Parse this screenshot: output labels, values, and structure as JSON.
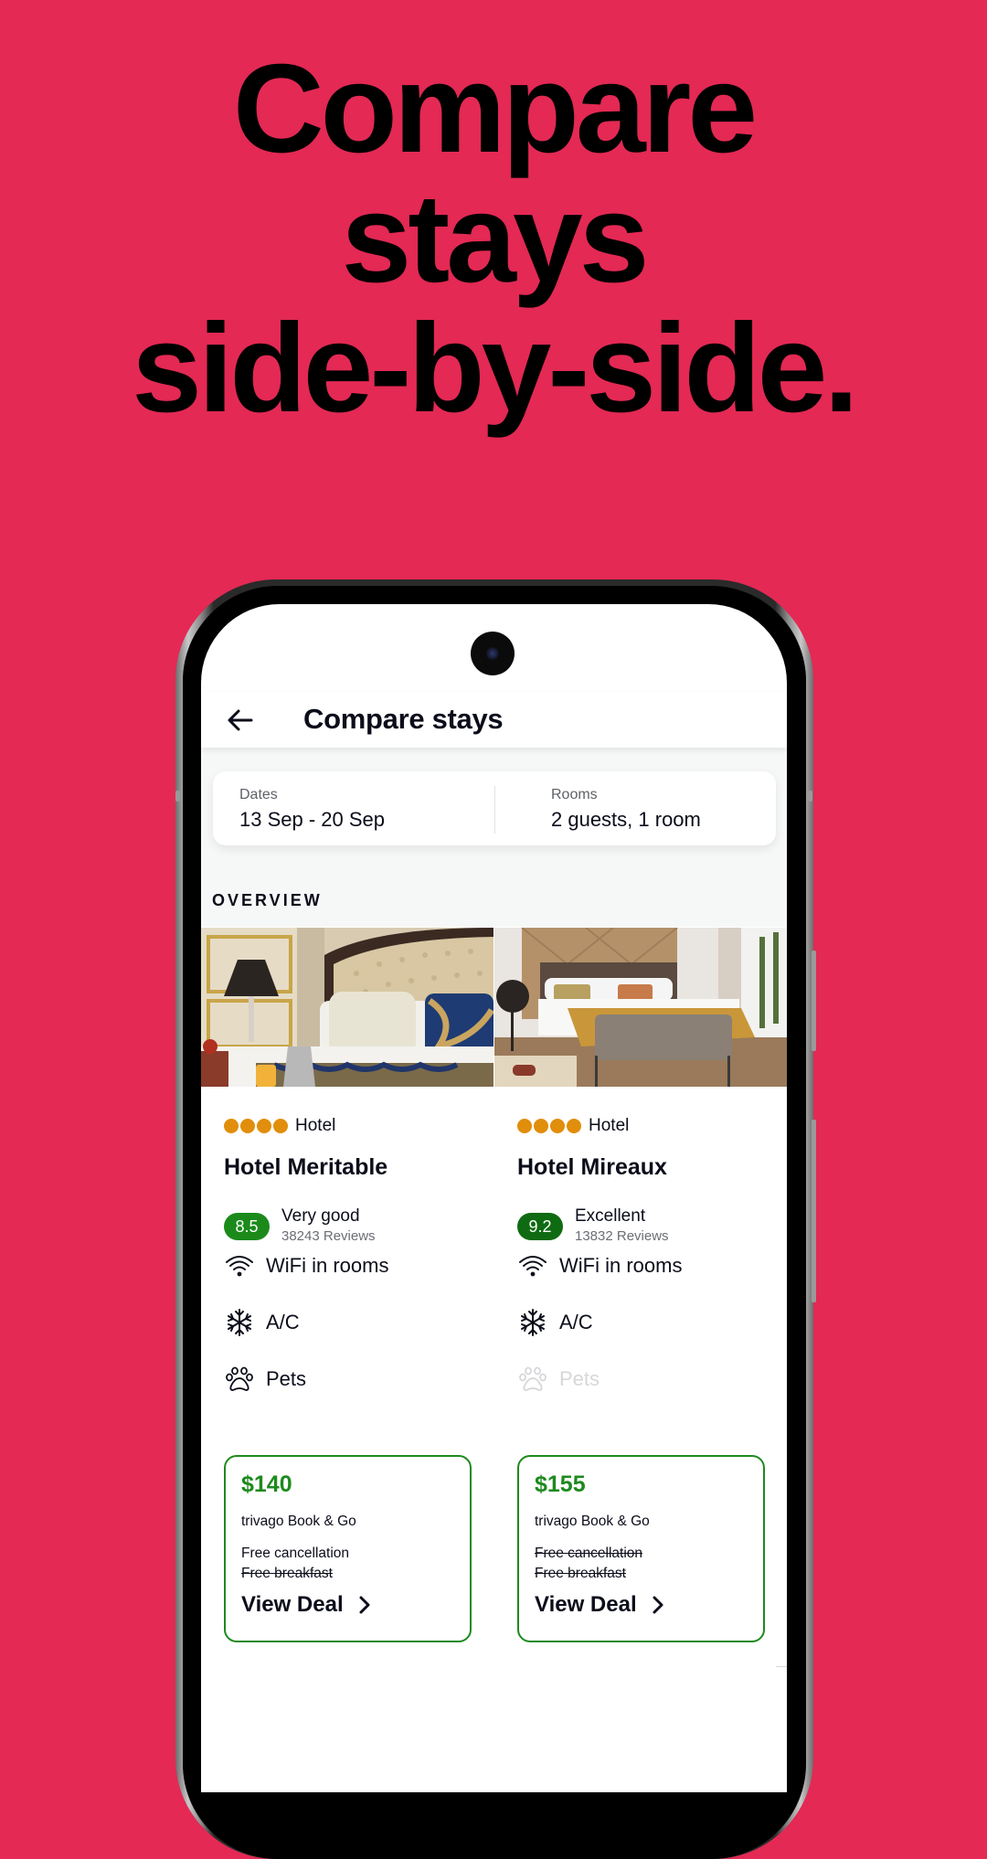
{
  "promo": {
    "headline_lines": [
      "Compare",
      "stays",
      "side-by-side."
    ],
    "background_color": "#E32954"
  },
  "app": {
    "header": {
      "back_icon": "arrow-left-icon",
      "title": "Compare stays"
    },
    "search": {
      "dates_label": "Dates",
      "dates_value": "13 Sep - 20 Sep",
      "rooms_label": "Rooms",
      "rooms_value": "2 guests, 1 room"
    },
    "section_label": "OVERVIEW",
    "colors": {
      "star": "#E08E0B",
      "price": "#1e8a1e",
      "deal_border": "#1e8a1e",
      "rating_very_good": "#1b8a1b",
      "rating_excellent": "#0f6b12"
    },
    "hotels": [
      {
        "photo": "hotel-room-photo-tufted-headboard",
        "stars": 4,
        "type": "Hotel",
        "name": "Hotel Meritable",
        "rating": "8.5",
        "rating_word": "Very good",
        "reviews": "38243 Reviews",
        "amenities": [
          {
            "icon": "wifi-icon",
            "label": "WiFi in rooms",
            "available": true
          },
          {
            "icon": "snowflake-icon",
            "label": "A/C",
            "available": true
          },
          {
            "icon": "paw-icon",
            "label": "Pets",
            "available": true
          }
        ],
        "deal": {
          "price": "$140",
          "provider": "trivago Book & Go",
          "perks": [
            {
              "label": "Free cancellation",
              "included": true
            },
            {
              "label": "Free breakfast",
              "included": false
            }
          ],
          "cta": "View Deal"
        }
      },
      {
        "photo": "hotel-room-photo-bench-bed",
        "stars": 4,
        "type": "Hotel",
        "name": "Hotel Mireaux",
        "rating": "9.2",
        "rating_word": "Excellent",
        "reviews": "13832 Reviews",
        "amenities": [
          {
            "icon": "wifi-icon",
            "label": "WiFi in rooms",
            "available": true
          },
          {
            "icon": "snowflake-icon",
            "label": "A/C",
            "available": true
          },
          {
            "icon": "paw-icon",
            "label": "Pets",
            "available": false
          }
        ],
        "deal": {
          "price": "$155",
          "provider": "trivago Book & Go",
          "perks": [
            {
              "label": "Free cancellation",
              "included": false
            },
            {
              "label": "Free breakfast",
              "included": false
            }
          ],
          "cta": "View Deal"
        }
      }
    ]
  }
}
